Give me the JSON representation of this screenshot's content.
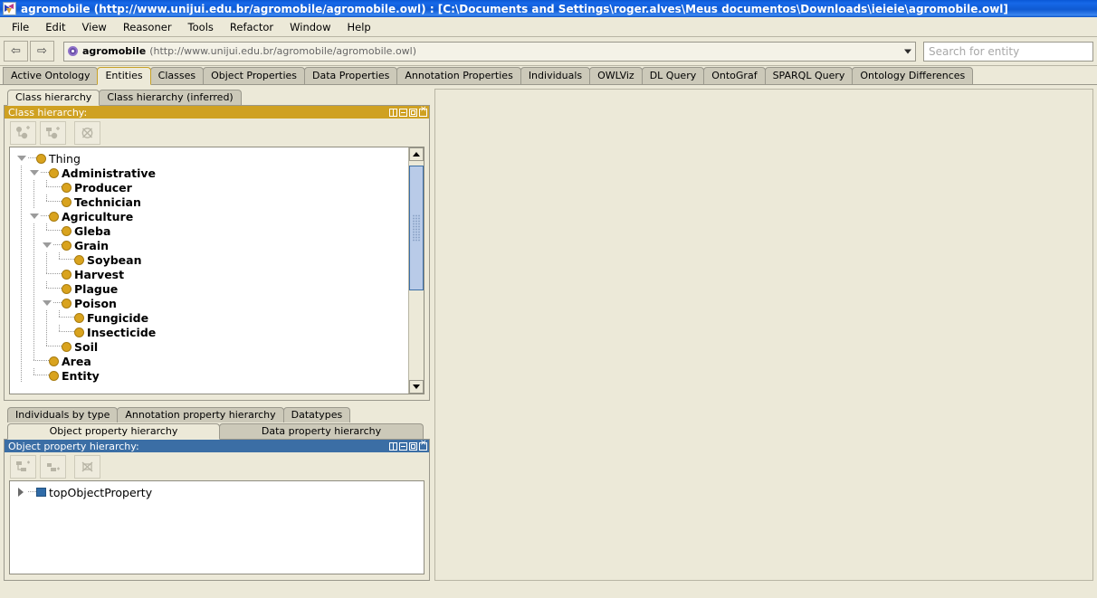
{
  "window": {
    "icon": "protege-app-icon",
    "title": "agromobile (http://www.unijui.edu.br/agromobile/agromobile.owl)  : [C:\\Documents and Settings\\roger.alves\\Meus documentos\\Downloads\\ieieie\\agromobile.owl]"
  },
  "menubar": {
    "items": [
      {
        "label": "File"
      },
      {
        "label": "Edit"
      },
      {
        "label": "View"
      },
      {
        "label": "Reasoner"
      },
      {
        "label": "Tools"
      },
      {
        "label": "Refactor"
      },
      {
        "label": "Window"
      },
      {
        "label": "Help"
      }
    ]
  },
  "toolbar": {
    "back_glyph": "⇦",
    "forward_glyph": "⇨",
    "ontology_name": "agromobile",
    "ontology_iri": "(http://www.unijui.edu.br/agromobile/agromobile.owl)",
    "search_placeholder": "Search for entity"
  },
  "main_tabs": {
    "selected": "Entities",
    "items": [
      {
        "label": "Active Ontology"
      },
      {
        "label": "Entities"
      },
      {
        "label": "Classes"
      },
      {
        "label": "Object Properties"
      },
      {
        "label": "Data Properties"
      },
      {
        "label": "Annotation Properties"
      },
      {
        "label": "Individuals"
      },
      {
        "label": "OWLViz"
      },
      {
        "label": "DL Query"
      },
      {
        "label": "OntoGraf"
      },
      {
        "label": "SPARQL Query"
      },
      {
        "label": "Ontology Differences"
      }
    ]
  },
  "class_panel": {
    "tabs": [
      {
        "label": "Class hierarchy"
      },
      {
        "label": "Class hierarchy (inferred)"
      }
    ],
    "selected_tab": "Class hierarchy",
    "header_title": "Class hierarchy:",
    "header_color": "#cfa122",
    "buttons": [
      {
        "name": "add-subclass-button"
      },
      {
        "name": "add-sibling-class-button"
      },
      {
        "name": "delete-class-button"
      }
    ],
    "tree": [
      {
        "label": "Thing",
        "depth": 0,
        "toggle": "expanded",
        "bold": false
      },
      {
        "label": "Administrative",
        "depth": 1,
        "toggle": "expanded",
        "bold": true
      },
      {
        "label": "Producer",
        "depth": 2,
        "toggle": "none",
        "bold": true
      },
      {
        "label": "Technician",
        "depth": 2,
        "toggle": "none",
        "bold": true
      },
      {
        "label": "Agriculture",
        "depth": 1,
        "toggle": "expanded",
        "bold": true
      },
      {
        "label": "Gleba",
        "depth": 2,
        "toggle": "none",
        "bold": true
      },
      {
        "label": "Grain",
        "depth": 2,
        "toggle": "expanded",
        "bold": true
      },
      {
        "label": "Soybean",
        "depth": 3,
        "toggle": "none",
        "bold": true
      },
      {
        "label": "Harvest",
        "depth": 2,
        "toggle": "none",
        "bold": true
      },
      {
        "label": "Plague",
        "depth": 2,
        "toggle": "none",
        "bold": true
      },
      {
        "label": "Poison",
        "depth": 2,
        "toggle": "expanded",
        "bold": true
      },
      {
        "label": "Fungicide",
        "depth": 3,
        "toggle": "none",
        "bold": true
      },
      {
        "label": "Insecticide",
        "depth": 3,
        "toggle": "none",
        "bold": true
      },
      {
        "label": "Soil",
        "depth": 2,
        "toggle": "none",
        "bold": true
      },
      {
        "label": "Area",
        "depth": 1,
        "toggle": "none",
        "bold": true
      },
      {
        "label": "Entity",
        "depth": 1,
        "toggle": "none",
        "bold": true
      }
    ],
    "scrollbar": {
      "up_glyph": "▲",
      "down_glyph": "▼",
      "thumb_top_pct": 2,
      "thumb_height_pct": 57
    }
  },
  "property_panel": {
    "upper_tabs": [
      {
        "label": "Individuals by type"
      },
      {
        "label": "Annotation property hierarchy"
      },
      {
        "label": "Datatypes"
      }
    ],
    "lower_tabs": [
      {
        "label": "Object property hierarchy",
        "selected": true
      },
      {
        "label": "Data property hierarchy",
        "selected": false
      }
    ],
    "header_title": "Object property hierarchy:",
    "header_color": "#3b6ea5",
    "buttons": [
      {
        "name": "add-subproperty-button"
      },
      {
        "name": "add-sibling-property-button"
      },
      {
        "name": "delete-property-button"
      }
    ],
    "tree": [
      {
        "label": "topObjectProperty",
        "depth": 0,
        "toggle": "collapsed"
      }
    ]
  }
}
